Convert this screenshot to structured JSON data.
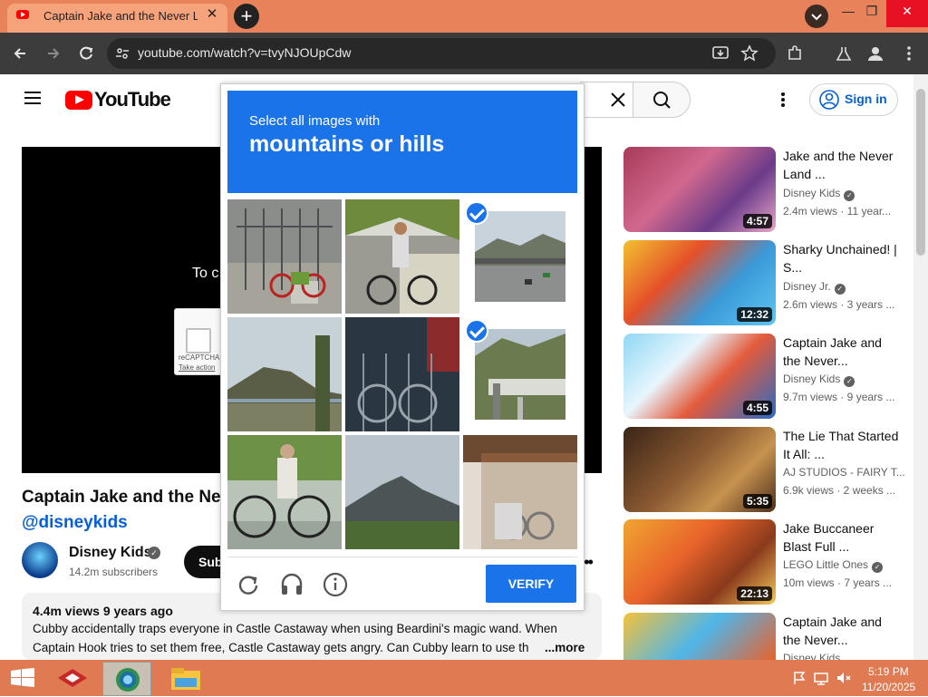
{
  "browser": {
    "tab_title": "Captain Jake and the Never Land Pirates",
    "tab_close": "✕",
    "new_tab": "+",
    "url": "youtube.com/watch?v=tvyNJOUpCdw"
  },
  "youtube": {
    "logo_text": "YouTube",
    "sign_in": "Sign in",
    "player_text": "To c",
    "recaptcha_small": "reCAPTCHA",
    "recaptcha_take_action": "Take action",
    "video_title": "Captain Jake and the Ne",
    "hashtag": "@disneykids",
    "channel_name": "Disney Kids",
    "subscribers": "14.2m subscribers",
    "subscribe_label": "Sub",
    "description": {
      "stats": "4.4m views  9 years ago",
      "line1": "Cubby accidentally traps everyone in Castle Castaway when using Beardini's magic wand. When",
      "line2": "Captain Hook tries to set them free, Castle Castaway gets angry. Can Cubby learn to use th",
      "more": "...more"
    }
  },
  "recommendations": [
    {
      "title": "Jake and the Never Land ...",
      "channel": "Disney Kids",
      "meta": "2.4m views · 11 year...",
      "duration": "4:57"
    },
    {
      "title": "Sharky Unchained! | S...",
      "channel": "Disney Jr.",
      "meta": "2.6m views · 3 years ...",
      "duration": "12:32"
    },
    {
      "title": "Captain Jake and the Never...",
      "channel": "Disney Kids",
      "meta": "9.7m views · 9 years ...",
      "duration": "4:55"
    },
    {
      "title": "The Lie That Started It All: ...",
      "channel": "AJ STUDIOS - FAIRY T...",
      "meta": "6.9k views · 2 weeks ...",
      "duration": "5:35"
    },
    {
      "title": "Jake Buccaneer Blast Full ...",
      "channel": "LEGO Little Ones",
      "meta": "10m views · 7 years ...",
      "duration": "22:13"
    },
    {
      "title": "Captain Jake and the Never...",
      "channel": "Disney Kids",
      "meta": "",
      "duration": ""
    }
  ],
  "captcha": {
    "instruction": "Select all images with",
    "target": "mountains or hills",
    "verify": "VERIFY",
    "tiles": [
      {
        "subject": "bicycles by gate",
        "selected": false
      },
      {
        "subject": "man on bicycle",
        "selected": false
      },
      {
        "subject": "highway with mountains",
        "selected": true
      },
      {
        "subject": "hill by water",
        "selected": false
      },
      {
        "subject": "parked bicycles",
        "selected": false
      },
      {
        "subject": "road through hills",
        "selected": true
      },
      {
        "subject": "woman on bicycle",
        "selected": false
      },
      {
        "subject": "volcano mountain",
        "selected": false
      },
      {
        "subject": "bicycle under shelter",
        "selected": false
      }
    ]
  },
  "taskbar": {
    "time": "5:19 PM",
    "date": "11/20/2025"
  }
}
